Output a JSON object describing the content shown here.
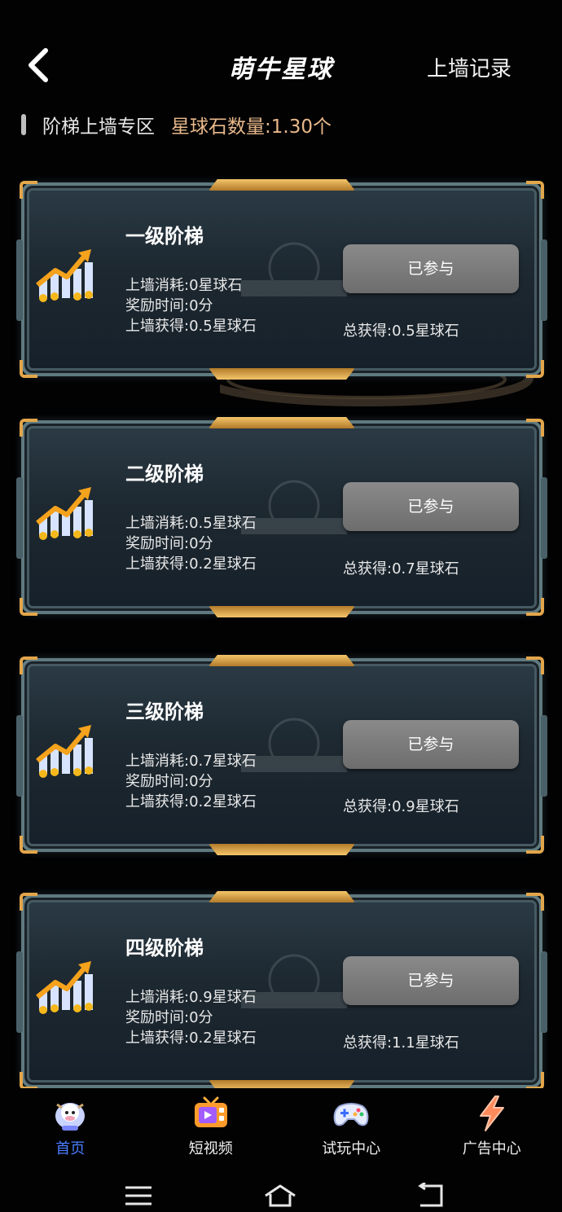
{
  "header": {
    "title": "萌牛星球",
    "record_label": "上墙记录"
  },
  "section": {
    "title": "阶梯上墙专区",
    "stone_label": "星球石数量:",
    "stone_value": "1.30个"
  },
  "cards": [
    {
      "name": "一级阶梯",
      "cost": "上墙消耗:0星球石",
      "reward_time": "奖励时间:0分",
      "gain": "上墙获得:0.5星球石",
      "button": "已参与",
      "total": "总获得:0.5星球石"
    },
    {
      "name": "二级阶梯",
      "cost": "上墙消耗:0.5星球石",
      "reward_time": "奖励时间:0分",
      "gain": "上墙获得:0.2星球石",
      "button": "已参与",
      "total": "总获得:0.7星球石"
    },
    {
      "name": "三级阶梯",
      "cost": "上墙消耗:0.7星球石",
      "reward_time": "奖励时间:0分",
      "gain": "上墙获得:0.2星球石",
      "button": "已参与",
      "total": "总获得:0.9星球石"
    },
    {
      "name": "四级阶梯",
      "cost": "上墙消耗:0.9星球石",
      "reward_time": "奖励时间:0分",
      "gain": "上墙获得:0.2星球石",
      "button": "已参与",
      "total": "总获得:1.1星球石"
    }
  ],
  "nav": {
    "items": [
      {
        "label": "首页",
        "icon": "cow-astronaut-icon",
        "active": true
      },
      {
        "label": "短视频",
        "icon": "tv-icon",
        "active": false
      },
      {
        "label": "试玩中心",
        "icon": "gamepad-icon",
        "active": false
      },
      {
        "label": "广告中心",
        "icon": "lightning-icon",
        "active": false
      }
    ]
  },
  "colors": {
    "accent_gold": "#e3a64a",
    "stone_text": "#e8b88a",
    "active_nav": "#4c7dff",
    "button_gray": "#7a7a7a"
  }
}
